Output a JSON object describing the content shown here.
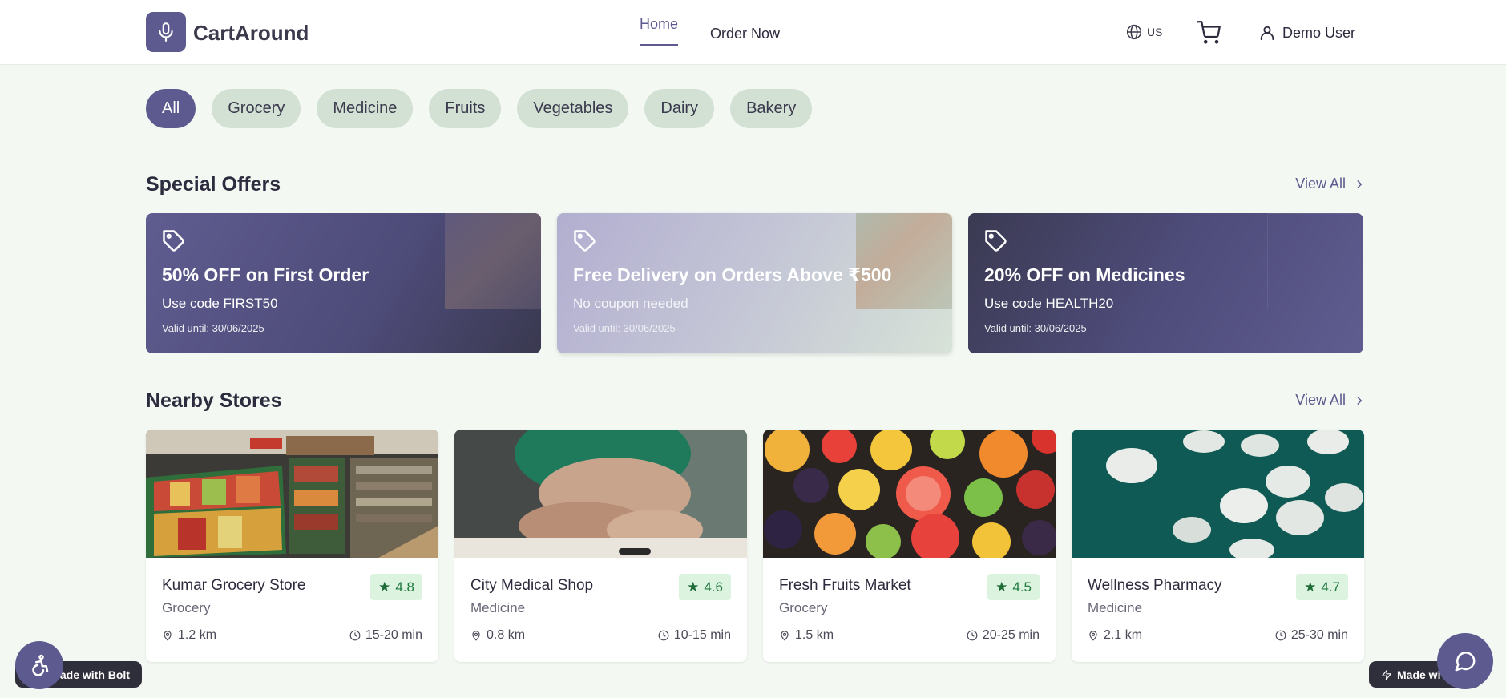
{
  "header": {
    "brand": "CartAround",
    "nav": {
      "home": "Home",
      "order_now": "Order Now"
    },
    "language": "US",
    "user_name": "Demo User"
  },
  "categories": [
    "All",
    "Grocery",
    "Medicine",
    "Fruits",
    "Vegetables",
    "Dairy",
    "Bakery"
  ],
  "special_offers": {
    "title": "Special Offers",
    "view_all": "View All",
    "items": [
      {
        "title": "50% OFF on First Order",
        "subtitle": "Use code FIRST50",
        "valid": "Valid until: 30/06/2025"
      },
      {
        "title": "Free Delivery on Orders Above ₹500",
        "subtitle": "No coupon needed",
        "valid": "Valid until: 30/06/2025"
      },
      {
        "title": "20% OFF on Medicines",
        "subtitle": "Use code HEALTH20",
        "valid": "Valid until: 30/06/2025"
      }
    ]
  },
  "nearby_stores": {
    "title": "Nearby Stores",
    "view_all": "View All",
    "items": [
      {
        "name": "Kumar Grocery Store",
        "category": "Grocery",
        "rating": "4.8",
        "distance": "1.2 km",
        "time": "15-20 min"
      },
      {
        "name": "City Medical Shop",
        "category": "Medicine",
        "rating": "4.6",
        "distance": "0.8 km",
        "time": "10-15 min"
      },
      {
        "name": "Fresh Fruits Market",
        "category": "Grocery",
        "rating": "4.5",
        "distance": "1.5 km",
        "time": "20-25 min"
      },
      {
        "name": "Wellness Pharmacy",
        "category": "Medicine",
        "rating": "4.7",
        "distance": "2.1 km",
        "time": "25-30 min"
      }
    ]
  },
  "widgets": {
    "bolt_left": "ade with Bolt",
    "bolt_right": "Made wi"
  },
  "colors": {
    "brand": "#5c5a8e",
    "background": "#f3f8f3",
    "chip": "#d3e0d4",
    "rating_bg": "#dcf3e0",
    "rating_text": "#1f7a3d"
  }
}
